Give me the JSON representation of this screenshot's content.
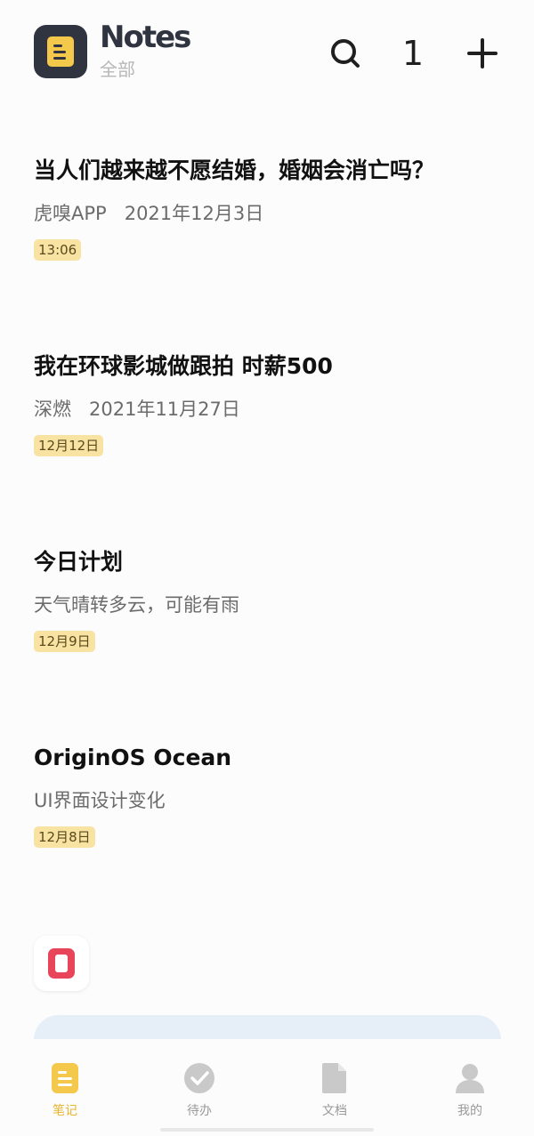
{
  "header": {
    "app_name": "Notes",
    "folder": "全部",
    "count": "1",
    "icons": {
      "app": "notes-app-icon",
      "search": "search-icon",
      "add": "plus-icon"
    }
  },
  "notes": [
    {
      "title": "当人们越来越不愿结婚，婚姻会消亡吗？",
      "source": "虎嗅APP",
      "date": "2021年12月3日",
      "time": "13:06"
    },
    {
      "title": "我在环球影城做跟拍  时薪500",
      "source": "深燃",
      "date": "2021年11月27日",
      "time": "12月12日"
    },
    {
      "title": "今日计划",
      "source": "天气晴转多云，可能有雨",
      "date": "",
      "time": "12月9日"
    },
    {
      "title": "OriginOS  Ocean",
      "source": "UI界面设计变化",
      "date": "",
      "time": "12月8日"
    }
  ],
  "bottom_nav": [
    {
      "label": "笔记",
      "icon": "note-icon",
      "active": true
    },
    {
      "label": "待办",
      "icon": "check-circle-icon",
      "active": false
    },
    {
      "label": "文档",
      "icon": "document-icon",
      "active": false
    },
    {
      "label": "我的",
      "icon": "person-icon",
      "active": false
    }
  ],
  "colors": {
    "accent": "#e8b530",
    "badge_bg": "#f9e3a3",
    "app_icon_bg": "#2f3440",
    "widget_red": "#e8455b",
    "promo_bg": "#e6eef8"
  }
}
